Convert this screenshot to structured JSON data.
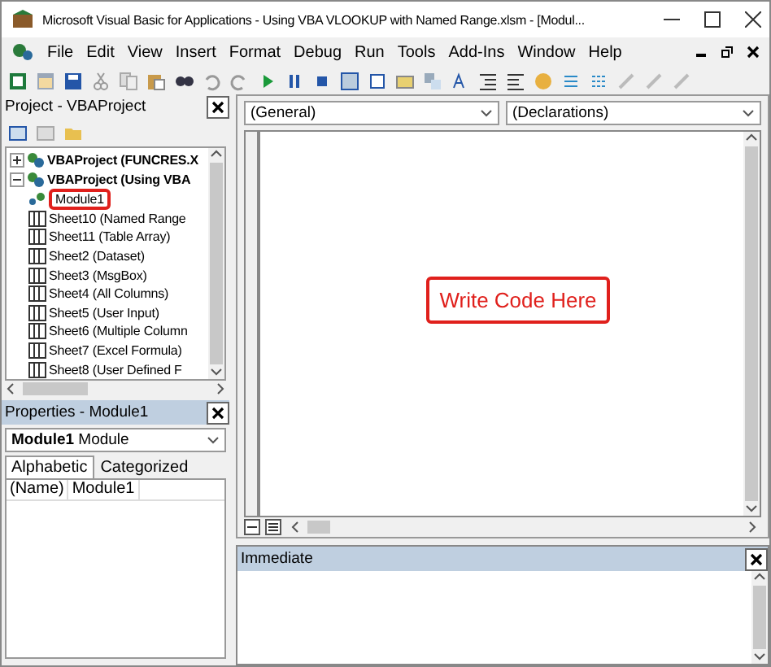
{
  "window": {
    "title": "Microsoft Visual Basic for Applications - Using VBA VLOOKUP with Named Range.xlsm - [Modul..."
  },
  "menu": [
    "File",
    "Edit",
    "View",
    "Insert",
    "Format",
    "Debug",
    "Run",
    "Tools",
    "Add-Ins",
    "Window",
    "Help"
  ],
  "project_panel": {
    "title": "Project - VBAProject",
    "tree": [
      {
        "label": "VBAProject (FUNCRES.X",
        "kind": "project",
        "expanded": false,
        "selected": false
      },
      {
        "label": "VBAProject (Using VBA",
        "kind": "project",
        "expanded": true,
        "selected": false,
        "children": [
          {
            "label": "Module1",
            "kind": "module",
            "selected": true
          },
          {
            "label": "Sheet10 (Named Range",
            "kind": "sheet",
            "selected": false
          },
          {
            "label": "Sheet11 (Table Array)",
            "kind": "sheet",
            "selected": false
          },
          {
            "label": "Sheet2 (Dataset)",
            "kind": "sheet",
            "selected": false
          },
          {
            "label": "Sheet3 (MsgBox)",
            "kind": "sheet",
            "selected": false
          },
          {
            "label": "Sheet4 (All Columns)",
            "kind": "sheet",
            "selected": false
          },
          {
            "label": "Sheet5 (User Input)",
            "kind": "sheet",
            "selected": false
          },
          {
            "label": "Sheet6 (Multiple Column",
            "kind": "sheet",
            "selected": false
          },
          {
            "label": "Sheet7 (Excel Formula)",
            "kind": "sheet",
            "selected": false
          },
          {
            "label": "Sheet8 (User Defined F",
            "kind": "sheet",
            "selected": false
          }
        ]
      }
    ]
  },
  "properties_panel": {
    "title": "Properties - Module1",
    "object_name": "Module1",
    "object_type": "Module",
    "tabs": [
      {
        "label": "Alphabetic",
        "selected": true
      },
      {
        "label": "Categorized",
        "selected": false
      }
    ],
    "rows": [
      {
        "name": "(Name)",
        "value": "Module1"
      }
    ]
  },
  "code_window": {
    "object_dropdown": "(General)",
    "procedure_dropdown": "(Declarations)",
    "annotation": "Write Code Here"
  },
  "immediate_panel": {
    "title": "Immediate"
  }
}
